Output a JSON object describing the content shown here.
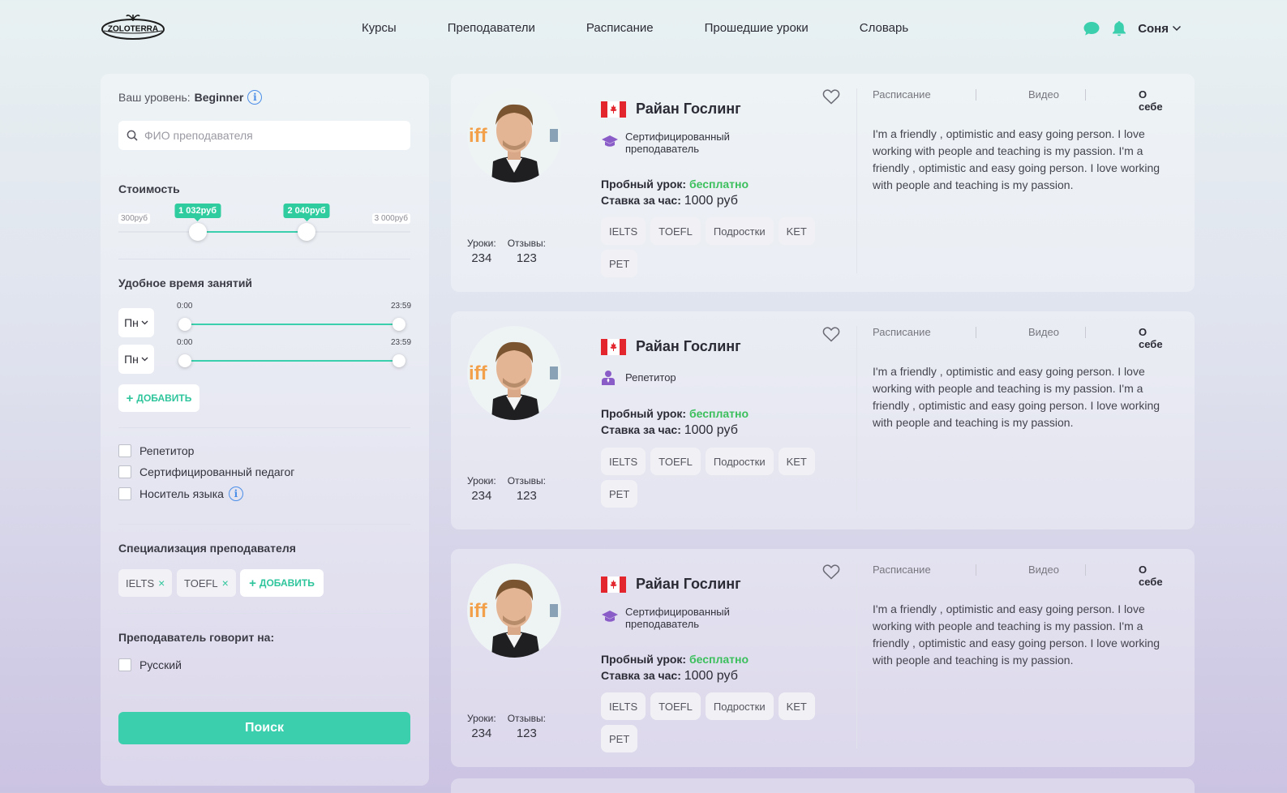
{
  "header": {
    "logo_text": "ZOLOTERRA",
    "nav": [
      "Курсы",
      "Преподаватели",
      "Расписание",
      "Прошедшие уроки",
      "Словарь"
    ],
    "user_name": "Соня"
  },
  "sidebar": {
    "level_label": "Ваш уровень:",
    "level_value": "Beginner",
    "search_placeholder": "ФИО преподавателя",
    "price_title": "Стоимость",
    "price_min": "300руб",
    "price_max": "3 000руб",
    "price_from_label": "1 032руб",
    "price_to_label": "2 040руб",
    "price_range_bounds": [
      300,
      3000
    ],
    "price_selected": [
      1032,
      2040
    ],
    "time_title": "Удобное время занятий",
    "time_rows": [
      {
        "day": "Пн",
        "from": "0:00",
        "to": "23:59"
      },
      {
        "day": "Пн",
        "from": "0:00",
        "to": "23:59"
      }
    ],
    "add_label": "ДОБАВИТЬ",
    "checkboxes": [
      "Репетитор",
      "Сертифицированный педагог",
      "Носитель языка"
    ],
    "specialization_title": "Специализация преподавателя",
    "specialization_chips": [
      "IELTS",
      "TOEFL"
    ],
    "speaks_title": "Преподаватель говорит на:",
    "speaks_options": [
      "Русский"
    ],
    "search_button": "Поиск"
  },
  "teachers": [
    {
      "name": "Райан Гослинг",
      "badge": "Сертифицированный преподаватель",
      "badge_type": "graduation-cap-icon",
      "trial_label": "Пробный урок:",
      "trial_value": "бесплатно",
      "rate_label": "Ставка за час:",
      "rate_value": "1000 руб",
      "tags": [
        "IELTS",
        "TOEFL",
        "Подростки",
        "KET",
        "PET"
      ],
      "lessons_label": "Уроки:",
      "lessons": "234",
      "reviews_label": "Отзывы:",
      "reviews": "123",
      "tabs": [
        "Расписание",
        "Видео",
        "О себе"
      ],
      "about": "I'm a friendly , optimistic and easy going person. I love working with people and teaching is my passion. I'm a friendly , optimistic and easy going person. I love working with people and teaching is my passion."
    },
    {
      "name": "Райан Гослинг",
      "badge": "Репетитор",
      "badge_type": "person-icon",
      "trial_label": "Пробный урок:",
      "trial_value": "бесплатно",
      "rate_label": "Ставка за час:",
      "rate_value": "1000 руб",
      "tags": [
        "IELTS",
        "TOEFL",
        "Подростки",
        "KET",
        "PET"
      ],
      "lessons_label": "Уроки:",
      "lessons": "234",
      "reviews_label": "Отзывы:",
      "reviews": "123",
      "tabs": [
        "Расписание",
        "Видео",
        "О себе"
      ],
      "about": "I'm a friendly , optimistic and easy going person. I love working with people and teaching is my passion. I'm a friendly , optimistic and easy going person. I love working with people and teaching is my passion."
    },
    {
      "name": "Райан Гослинг",
      "badge": "Сертифицированный преподаватель",
      "badge_type": "graduation-cap-icon",
      "trial_label": "Пробный урок:",
      "trial_value": "бесплатно",
      "rate_label": "Ставка за час:",
      "rate_value": "1000 руб",
      "tags": [
        "IELTS",
        "TOEFL",
        "Подростки",
        "KET",
        "PET"
      ],
      "lessons_label": "Уроки:",
      "lessons": "234",
      "reviews_label": "Отзывы:",
      "reviews": "123",
      "tabs": [
        "Расписание",
        "Видео",
        "О себе"
      ],
      "about": "I'm a friendly , optimistic and easy going person. I love working with people and teaching is my passion. I'm a friendly , optimistic and easy going person. I love working with people and teaching is my passion."
    }
  ],
  "colors": {
    "accent": "#3ccfae",
    "free_text": "#3bbf5c",
    "info_blue": "#4b8ee8",
    "badge_purple": "#8a5cc7"
  }
}
